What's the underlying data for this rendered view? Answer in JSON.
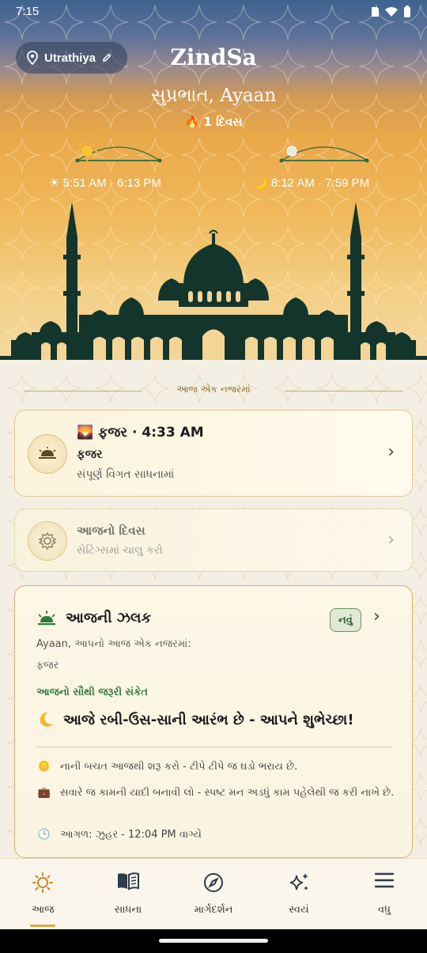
{
  "status": {
    "time": "7:15"
  },
  "header": {
    "location": "Utrathiya",
    "app_title": "ZindSa",
    "greeting": "સુપ્રભાત, Ayaan",
    "streak": "🔥 1 દિવસ",
    "sun_times": "☀ 5:51 AM · 6:13 PM",
    "moon_times": "🌙 8:12 AM · 7:59 PM"
  },
  "section_title": "આજ એક નજરમાં",
  "fajr_card": {
    "line1": "🌄 ફજર · 4:33 AM",
    "line2": "ફજર",
    "line3": "સંપૂર્ણ વિગત સાધનામાં"
  },
  "day_card": {
    "line1": "આજનો દિવસ",
    "line2": "સેટિંગ્સમાં ચાલુ કરો"
  },
  "glimpse": {
    "title": "આજની ઝલક",
    "badge": "નવું",
    "subtitle": "Ayaan, આપનો આજ એક નજરમાં:",
    "subtitle2": "ફજર",
    "important_label": "આજનો સૌથી જરૂરી સંકેત",
    "important_text": "આજે રબી-ઉસ-સાની આરંભ છે - આપને શુભેચ્છા!",
    "items": [
      {
        "icon": "🪙",
        "text": "નાની બચત આજથી શરૂ કરો - ટીપે ટીપે જ ઘડો ભરાય છે."
      },
      {
        "icon": "💼",
        "text": "સવારે જ કામની યાદી બનાવી લો - સ્પષ્ટ મન અડધું કામ પહેલેથી જ કરી નાખે છે."
      },
      {
        "icon": "🕒",
        "text": "આગળ: ઝુહર - 12:04 PM વાગ્યે"
      }
    ]
  },
  "nav": {
    "items": [
      {
        "label": "આજ",
        "icon": "sun-icon",
        "active": true
      },
      {
        "label": "સાધના",
        "icon": "book-icon"
      },
      {
        "label": "માર્ગદર્શન",
        "icon": "compass-icon"
      },
      {
        "label": "સ્વયં",
        "icon": "sparkles-icon"
      },
      {
        "label": "વધુ",
        "icon": "menu-icon"
      }
    ]
  },
  "colors": {
    "accent": "#e0a542",
    "green": "#2d7a3e",
    "sky_top": "#3f6390",
    "sky_bottom": "#f4d9a0"
  }
}
